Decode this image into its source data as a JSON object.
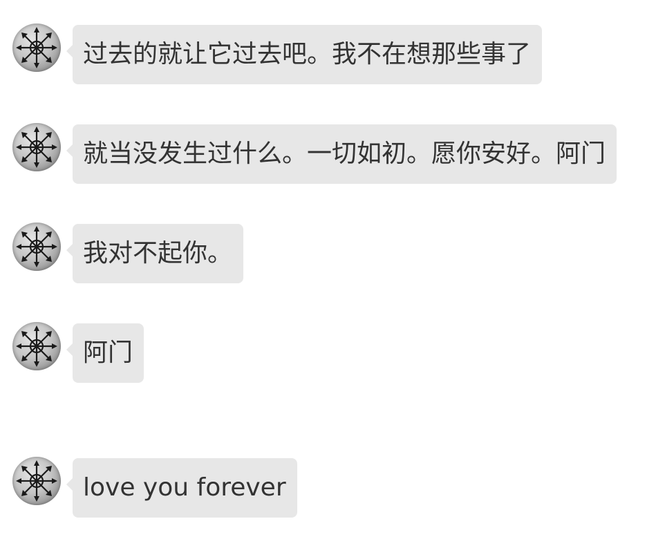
{
  "messages": [
    {
      "text": "过去的就让它过去吧。我不在想那些事了"
    },
    {
      "text": "就当没发生过什么。一切如初。愿你安好。阿门"
    },
    {
      "text": "我对不起你。"
    },
    {
      "text": "阿门"
    },
    {
      "text": "love you forever"
    }
  ],
  "avatar_icon": "chaos-star-emblem-icon",
  "colors": {
    "background": "#ffffff",
    "bubble": "#e7e7e7",
    "text": "#333333"
  }
}
